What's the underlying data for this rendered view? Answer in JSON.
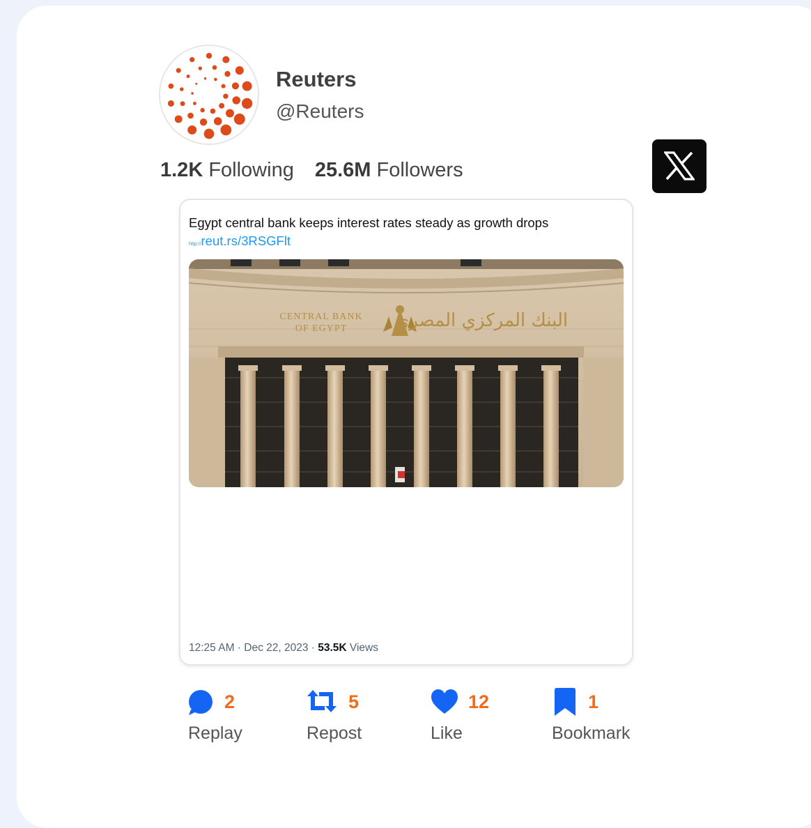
{
  "profile": {
    "name": "Reuters",
    "handle": "@Reuters",
    "following_count": "1.2K",
    "following_label": "Following",
    "followers_count": "25.6M",
    "followers_label": "Followers",
    "avatar_icon": "reuters-logo-icon",
    "platform_icon": "x-logo-icon"
  },
  "tweet": {
    "text": "Egypt central bank keeps interest rates steady as growth drops",
    "link_protocol": "http://",
    "link": "reut.rs/3RSGFlt",
    "image_signage_en_line1": "CENTRAL BANK",
    "image_signage_en_line2": "OF EGYPT",
    "image_signage_ar": "البنك المركزي المصري",
    "time_date": "12:25 AM · Dec 22, 2023 · ",
    "views_count": "53.5K",
    "views_label": " Views"
  },
  "actions": [
    {
      "icon": "comment-icon",
      "count": "2",
      "label": "Replay"
    },
    {
      "icon": "repost-icon",
      "count": "5",
      "label": "Repost"
    },
    {
      "icon": "heart-icon",
      "count": "12",
      "label": "Like"
    },
    {
      "icon": "bookmark-icon",
      "count": "1",
      "label": "Bookmark"
    }
  ],
  "colors": {
    "brand_orange": "#dd4b1a",
    "count_orange": "#ef6c1a",
    "action_blue": "#1565f5",
    "link_blue": "#1d9bf0"
  }
}
